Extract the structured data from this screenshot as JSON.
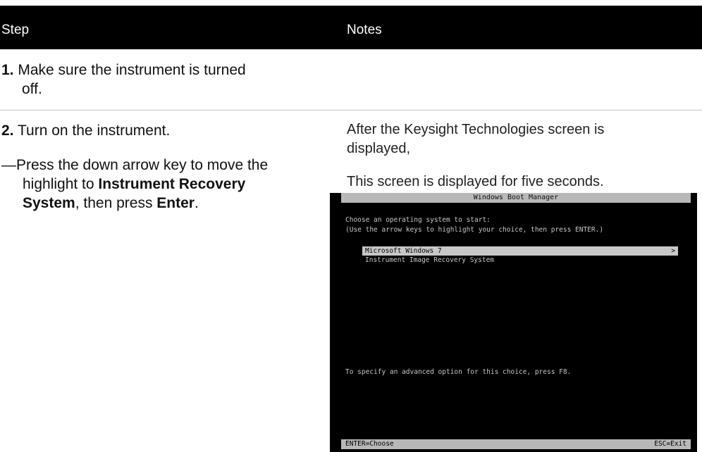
{
  "table": {
    "headers": {
      "step": "Step",
      "notes": "Notes"
    },
    "rows": [
      {
        "step_num": "1.",
        "step_text": "Make sure the instrument is turned",
        "step_text2": "off."
      },
      {
        "step_num": "2.",
        "step_text": "Turn on the instrument.",
        "sub_prefix": "—Press the down arrow key to move the",
        "sub_line2_pre": "highlight to ",
        "sub_bold1": "Instrument Recovery",
        "sub_bold2": "System",
        "sub_mid": ", then press ",
        "sub_bold3": "Enter",
        "sub_end": ".",
        "note1": "After the Keysight Technologies screen is",
        "note1b": "displayed,",
        "note2": "This screen is displayed for five seconds."
      }
    ]
  },
  "boot_manager": {
    "title": "Windows Boot Manager",
    "prompt1": "Choose an operating system to start:",
    "prompt2": "(Use the arrow keys to highlight your choice, then press ENTER.)",
    "options": [
      "Microsoft Windows 7",
      "Instrument Image Recovery System"
    ],
    "selected_arrow": ">",
    "advanced": "To specify an advanced option for this choice, press F8.",
    "footer_left": "ENTER=Choose",
    "footer_right": "ESC=Exit"
  }
}
